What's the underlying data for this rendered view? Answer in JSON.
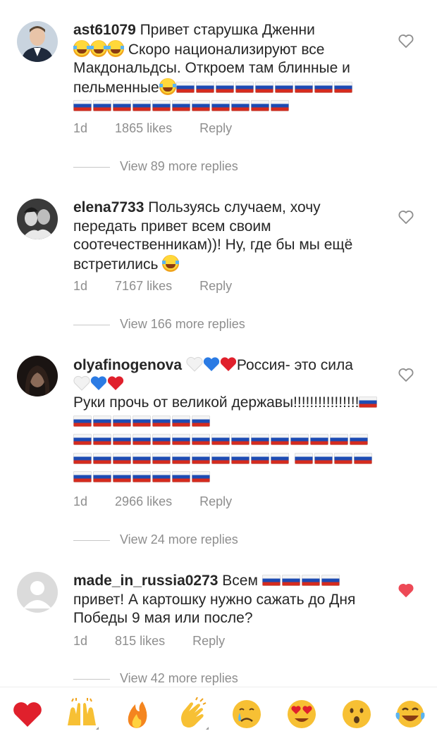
{
  "comments": [
    {
      "username": "ast61079",
      "text1": " Привет старушка Дженни",
      "text2": " Скоро национализируют все Макдональдсы. Откроем там блинные и пельменные",
      "time": "1d",
      "likes": "1865 likes",
      "reply": "Reply",
      "view_replies": "View 89 more replies",
      "liked": false
    },
    {
      "username": "elena7733",
      "text1": " Пользуясь случаем, хочу передать привет всем своим соотечественникам))! Ну, где бы мы ещё встретились ",
      "time": "1d",
      "likes": "7167 likes",
      "reply": "Reply",
      "view_replies": "View 166 more replies",
      "liked": false
    },
    {
      "username": "olyafinogenova",
      "text1": "Россия- это сила",
      "text2": "Руки прочь от великой державы!!!!!!!!!!!!!!!!",
      "time": "1d",
      "likes": "2966 likes",
      "reply": "Reply",
      "view_replies": "View 24 more replies",
      "liked": false
    },
    {
      "username": "made_in_russia0273",
      "text1": " Всем ",
      "text2": " привет! А картошку нужно сажать до Дня Победы 9 мая или после?",
      "time": "1d",
      "likes": "815 likes",
      "reply": "Reply",
      "view_replies": "View 42 more replies",
      "liked": true
    }
  ],
  "reaction_bar": [
    "red-heart-icon",
    "raising-hands-icon",
    "fire-icon",
    "clapping-hands-icon",
    "crying-face-icon",
    "heart-eyes-icon",
    "surprised-face-icon",
    "laughing-tears-icon"
  ],
  "colors": {
    "like_red": "#ed4956",
    "meta_gray": "#8e8e8e",
    "text": "#262626"
  }
}
